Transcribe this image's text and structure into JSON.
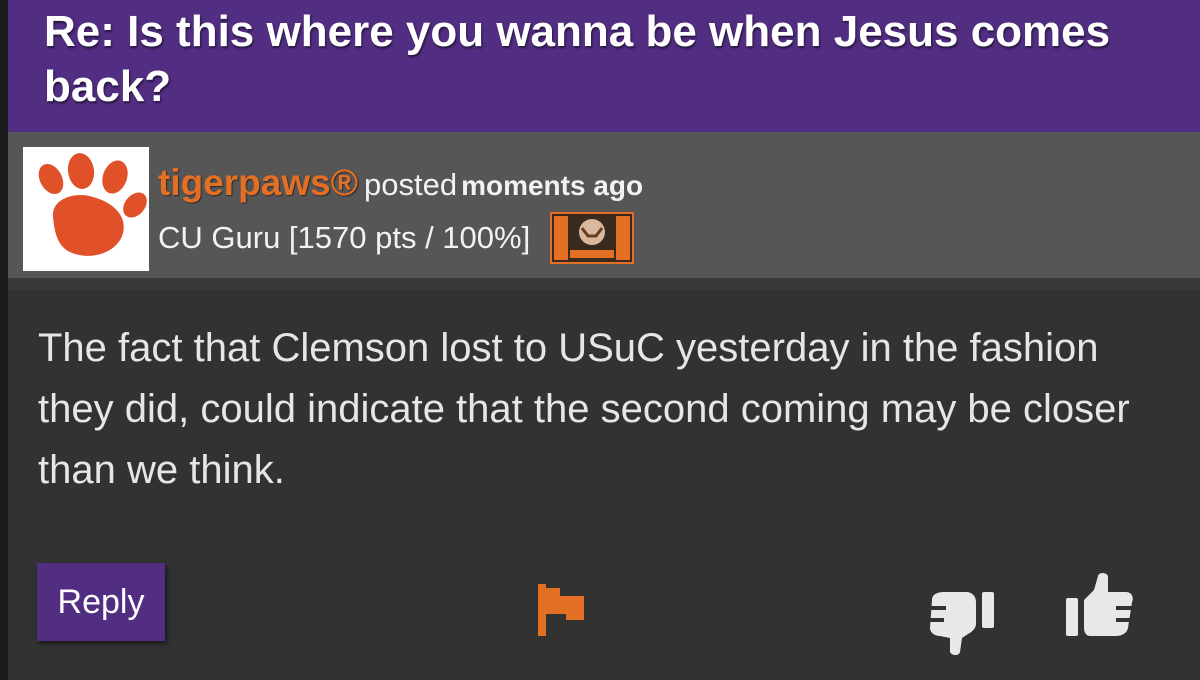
{
  "thread": {
    "title": "Re: Is this where you wanna be when Jesus comes back?"
  },
  "author": {
    "username": "tigerpaws®",
    "posted_label": "posted",
    "posted_time": "moments ago",
    "rank": "CU Guru [1570 pts / 100%]",
    "avatar_icon": "tiger-paw-icon",
    "badge_icon": "premium-badge-icon"
  },
  "post": {
    "body": "The fact that Clemson lost to USuC yesterday in the fashion they did, could indicate that the second coming may be closer than we think."
  },
  "actions": {
    "reply_label": "Reply",
    "flag_icon": "flag-icon",
    "thumbs_down_icon": "thumbs-down-icon",
    "thumbs_up_icon": "thumbs-up-icon"
  },
  "colors": {
    "brand_purple": "#522e82",
    "brand_orange": "#e36f25",
    "author_bar": "#565656",
    "body_bg": "#323232",
    "text_light": "#e6e6e6"
  }
}
